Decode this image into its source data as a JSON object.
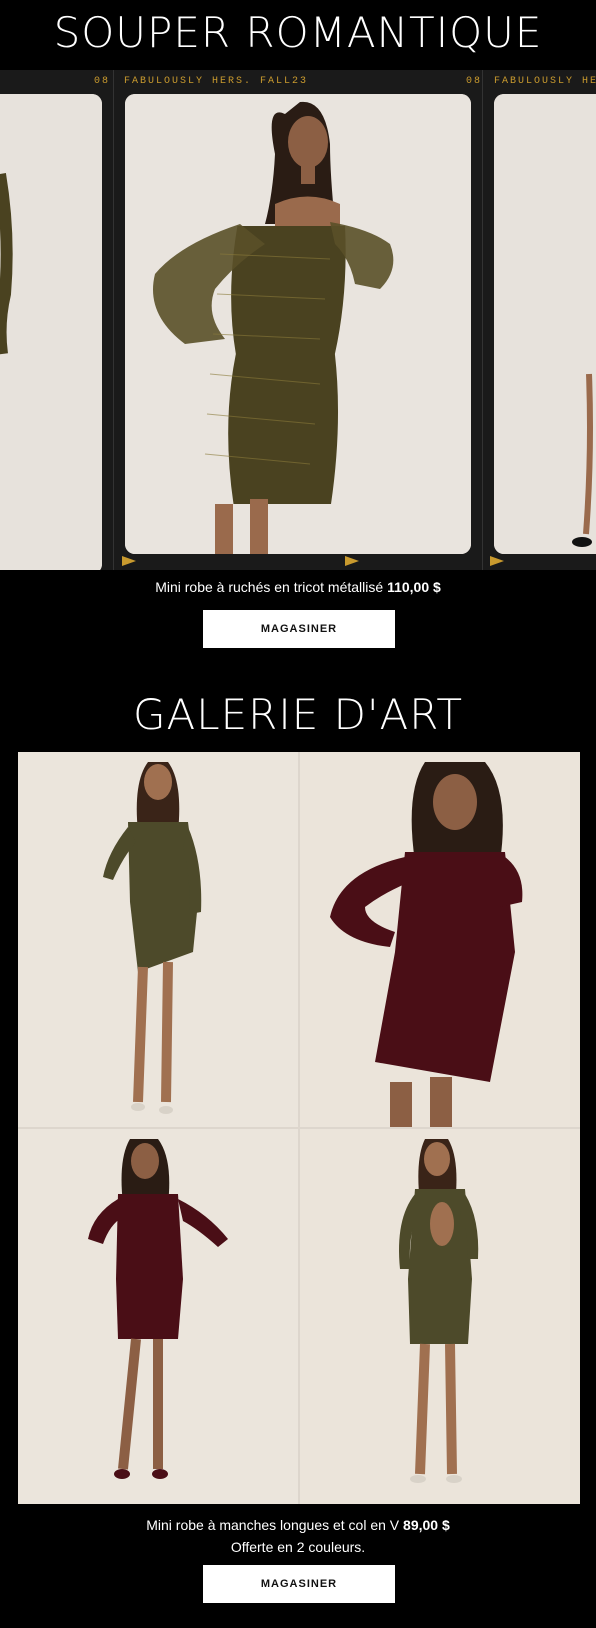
{
  "section1": {
    "title": "SOUPER ROMANTIQUE",
    "frame_labels": [
      "08",
      "FABULOUSLY HERS. FALL23",
      "08",
      "FABULOUSLY HERS."
    ],
    "product_name": "Mini robe à ruchés en tricot métallisé",
    "product_price": "110,00 $",
    "cta_label": "MAGASINER"
  },
  "section2": {
    "title": "GALERIE D'ART",
    "product_name": "Mini robe à manches longues et col en V",
    "product_price": "89,00 $",
    "product_note": "Offerte en 2 couleurs.",
    "cta_label": "MAGASINER"
  },
  "colors": {
    "background": "#000000",
    "accent": "#c99a2e",
    "dress_metallic": "#4a4220",
    "dress_olive": "#4d4a2a",
    "dress_burgundy": "#4a0e16",
    "photo_bg": "#e9e4de"
  }
}
